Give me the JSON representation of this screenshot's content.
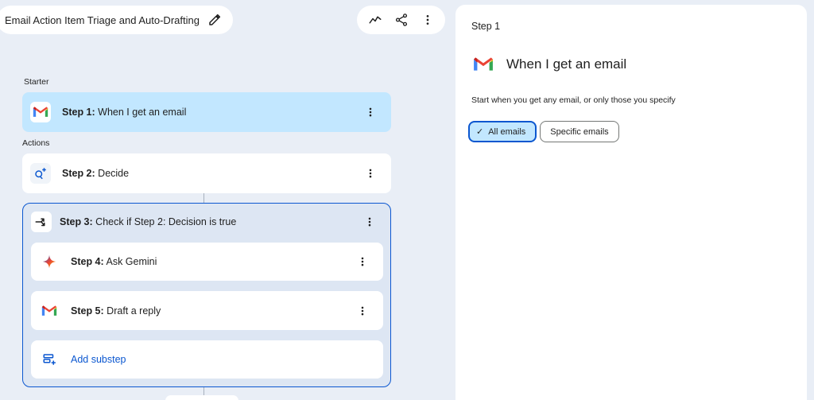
{
  "header": {
    "title": "Email Action Item Triage and Auto-Drafting"
  },
  "sections": {
    "starter": "Starter",
    "actions": "Actions"
  },
  "steps": [
    {
      "num": "Step 1:",
      "label": "When I get an email",
      "icon": "gmail-icon"
    },
    {
      "num": "Step 2:",
      "label": "Decide",
      "icon": "decide-icon"
    },
    {
      "num": "Step 3:",
      "label": "Check if Step 2: Decision is true",
      "icon": "branch-icon"
    },
    {
      "num": "Step 4:",
      "label": "Ask Gemini",
      "icon": "gemini-icon"
    },
    {
      "num": "Step 5:",
      "label": "Draft a reply",
      "icon": "gmail-icon"
    }
  ],
  "add_substep": "Add substep",
  "panel": {
    "step_label": "Step 1",
    "title": "When I get an email",
    "description": "Start when you get any email, or only those you specify",
    "options": [
      {
        "label": "All emails",
        "selected": true
      },
      {
        "label": "Specific emails",
        "selected": false
      }
    ]
  },
  "colors": {
    "accent": "#0b57d0",
    "active_step": "#c2e7ff",
    "background": "#e9eef6"
  }
}
